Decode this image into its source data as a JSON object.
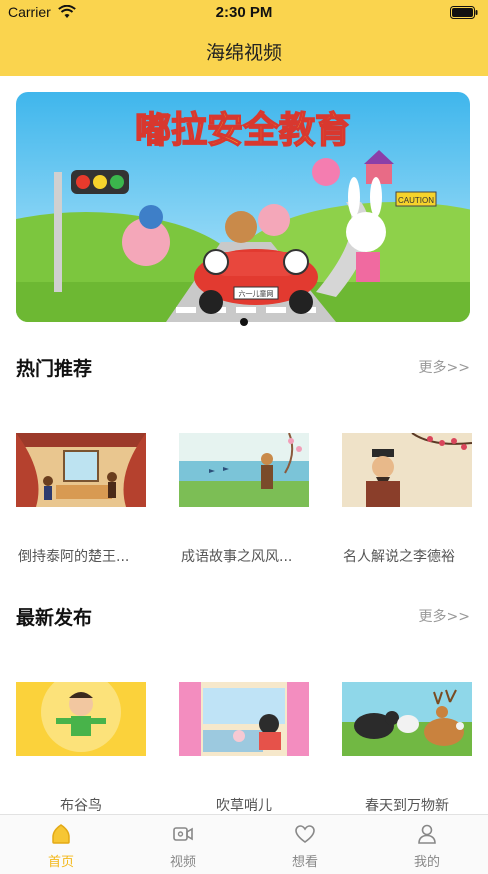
{
  "status": {
    "carrier": "Carrier",
    "time": "2:30 PM"
  },
  "nav": {
    "title": "海绵视频"
  },
  "banner": {
    "headline": "嘟拉安全教育",
    "sign": "CAUTION",
    "car_plate": "六一儿童网"
  },
  "sections": [
    {
      "title": "热门推荐",
      "more": "更多>>",
      "items": [
        {
          "title": "倒持泰阿的楚王..."
        },
        {
          "title": "成语故事之风风..."
        },
        {
          "title": "名人解说之李德裕"
        }
      ]
    },
    {
      "title": "最新发布",
      "more": "更多>>",
      "items": [
        {
          "title": "布谷鸟"
        },
        {
          "title": "吹草哨儿"
        },
        {
          "title": "春天到万物新"
        }
      ]
    }
  ],
  "tabs": [
    {
      "label": "首页",
      "icon": "home-icon",
      "active": true
    },
    {
      "label": "视频",
      "icon": "video-icon",
      "active": false
    },
    {
      "label": "想看",
      "icon": "heart-icon",
      "active": false
    },
    {
      "label": "我的",
      "icon": "person-icon",
      "active": false
    }
  ],
  "colors": {
    "brand_yellow": "#FAD44E",
    "active_tab": "#F3B81A",
    "more_gray": "#999999"
  }
}
